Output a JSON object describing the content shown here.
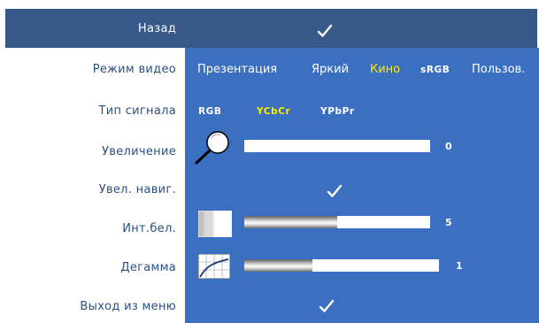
{
  "header": {
    "back_label": "Назад"
  },
  "rows": [
    {
      "label": "Режим видео"
    },
    {
      "label": "Тип сигнала"
    },
    {
      "label": "Увеличение"
    },
    {
      "label": "Увел. навиг."
    },
    {
      "label": "Инт.бел."
    },
    {
      "label": "Дегамма"
    },
    {
      "label": "Выход из меню"
    }
  ],
  "video_mode": {
    "options": [
      "Презентация",
      "Яркий",
      "Кино",
      "sRGB",
      "Пользов."
    ],
    "selected": "Кино"
  },
  "signal_type": {
    "options": [
      "RGB",
      "YCbCr",
      "YPbPr"
    ],
    "selected": "YCbCr"
  },
  "zoom": {
    "value": "0",
    "fraction": 0.0
  },
  "white_intensity": {
    "value": "5",
    "fraction": 0.5
  },
  "degamma": {
    "value": "1",
    "fraction": 0.35
  },
  "colors": {
    "header_bg": "#37598a",
    "panel_bg": "#3b6fc0",
    "label_text": "#2d4f7f",
    "selected_option": "#ffea00"
  },
  "icons": {
    "back": "check-icon",
    "zoom": "magnifier-icon",
    "zoom_nav": "check-icon",
    "white_intensity": "white-intensity-icon",
    "degamma": "degamma-curve-icon",
    "exit": "check-icon"
  }
}
